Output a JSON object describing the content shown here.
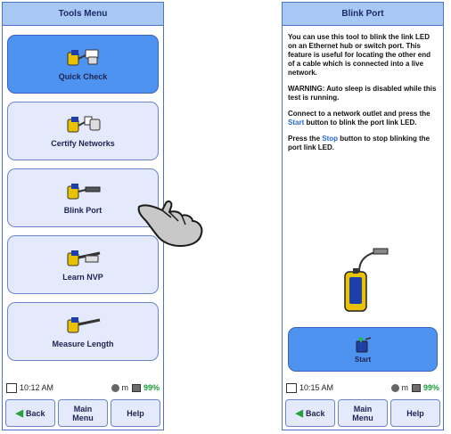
{
  "left_screen": {
    "title": "Tools Menu",
    "menu_items": [
      {
        "label": "Quick Check",
        "icon": "quick-check-icon",
        "selected": true
      },
      {
        "label": "Certify Networks",
        "icon": "certify-networks-icon",
        "selected": false
      },
      {
        "label": "Blink Port",
        "icon": "blink-port-icon",
        "selected": false
      },
      {
        "label": "Learn NVP",
        "icon": "learn-nvp-icon",
        "selected": false
      },
      {
        "label": "Measure Length",
        "icon": "measure-length-icon",
        "selected": false
      }
    ],
    "status": {
      "time": "10:12 AM",
      "units": "m",
      "battery": "99%"
    },
    "buttons": {
      "back": "Back",
      "main_menu_line1": "Main",
      "main_menu_line2": "Menu",
      "help": "Help"
    }
  },
  "right_screen": {
    "title": "Blink Port",
    "paragraphs": [
      "You can use this tool to blink the link LED on an Ethernet hub or switch port. This feature is useful for locating the other end of a cable which is connected into a live network.",
      "WARNING: Auto sleep is disabled while this test is running."
    ],
    "connect_pre": "Connect to a network outlet and press the ",
    "connect_action": "Start",
    "connect_post": " button to blink the port link LED.",
    "stop_pre": "Press the ",
    "stop_action": "Stop",
    "stop_post": " button to stop blinking the port link LED.",
    "start_label": "Start",
    "status": {
      "time": "10:15 AM",
      "units": "m",
      "battery": "99%"
    },
    "buttons": {
      "back": "Back",
      "main_menu_line1": "Main",
      "main_menu_line2": "Menu",
      "help": "Help"
    }
  },
  "colors": {
    "accent": "#4f93f1",
    "title_bar": "#a8c8f4",
    "button_bg": "#e4e9fb",
    "border": "#6b86c9"
  },
  "pointer_icon": "hand-pointer-icon"
}
